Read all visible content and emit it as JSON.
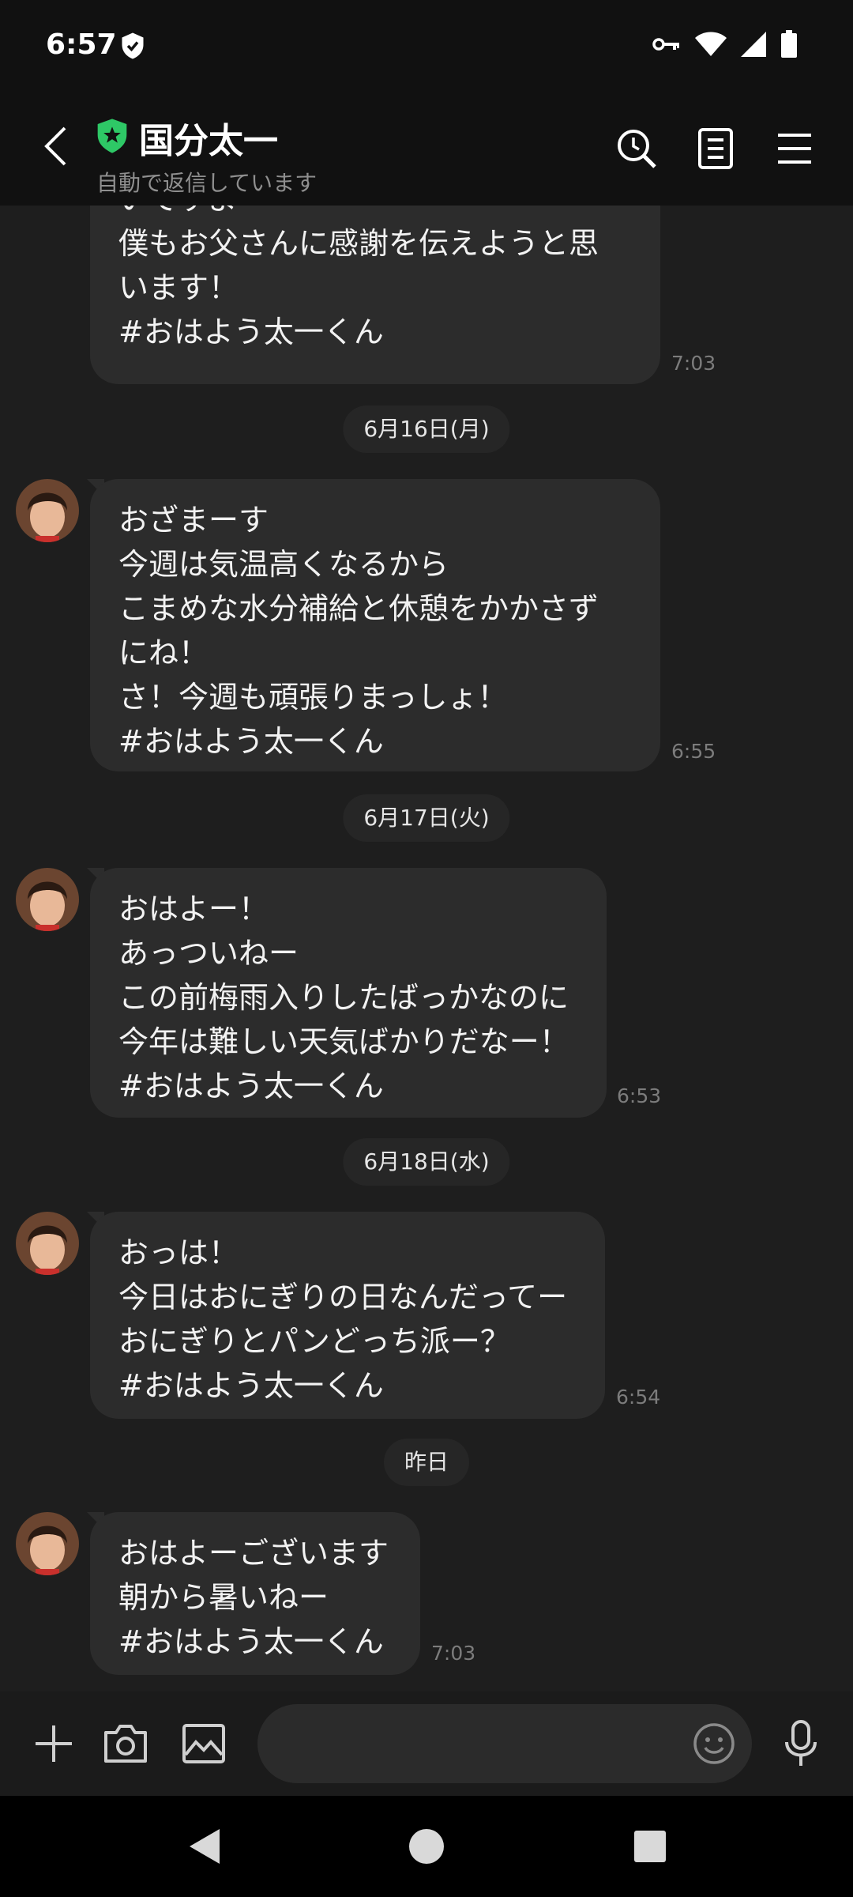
{
  "status_bar": {
    "time": "6:57",
    "icons": [
      "vpn-shield-icon",
      "key-icon",
      "wifi-icon",
      "cellular-signal-icon",
      "battery-icon"
    ]
  },
  "header": {
    "title": "国分太一",
    "subtitle": "自動で返信しています",
    "icons": [
      "back-arrow-icon",
      "official-badge-icon",
      "search-history-icon",
      "notes-icon",
      "menu-icon"
    ]
  },
  "chat": {
    "messages": [
      {
        "text": "いですよ\n僕もお父さんに感謝を伝えようと思\nいます！\n#おはよう太一くん",
        "time": "7:03"
      },
      {
        "text": "おざまーす\n今週は気温高くなるから\nこまめな水分補給と休憩をかかさず\nにね！\nさ！今週も頑張りまっしょ！\n#おはよう太一くん",
        "time": "6:55"
      },
      {
        "text": "おはよー！\nあっついねー\nこの前梅雨入りしたばっかなのに\n今年は難しい天気ばかりだなー！\n#おはよう太一くん",
        "time": "6:53"
      },
      {
        "text": "おっは！\n今日はおにぎりの日なんだってー\nおにぎりとパンどっち派ー？\n#おはよう太一くん",
        "time": "6:54"
      },
      {
        "text": "おはよーございます\n朝から暑いねー\n#おはよう太一くん",
        "time": "7:03"
      }
    ],
    "dates": [
      "6月16日(月)",
      "6月17日(火)",
      "6月18日(水)",
      "昨日"
    ]
  },
  "input_bar": {
    "message_value": "",
    "message_placeholder": "",
    "icons": [
      "plus-icon",
      "camera-icon",
      "image-icon",
      "emoji-icon",
      "microphone-icon"
    ]
  },
  "colors": {
    "background": "#1e1e1e",
    "bar": "#111111",
    "bubble": "#2c2c2c",
    "badge_green": "#2ec866",
    "timestamp": "#7c7c7c"
  }
}
